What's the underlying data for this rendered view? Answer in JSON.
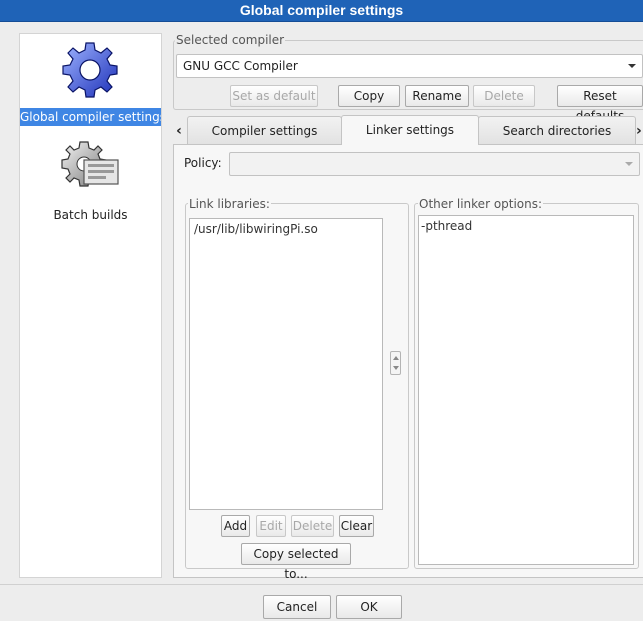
{
  "window": {
    "title": "Global compiler settings"
  },
  "sidebar": {
    "items": [
      {
        "label": "Global compiler settings",
        "icon": "gear-icon",
        "selected": true
      },
      {
        "label": "Batch builds",
        "icon": "gear-batch-icon",
        "selected": false
      }
    ]
  },
  "compiler": {
    "group_label": "Selected compiler",
    "selected_value": "GNU GCC Compiler",
    "buttons": {
      "set_default": "Set as default",
      "copy": "Copy",
      "rename": "Rename",
      "delete": "Delete",
      "reset": "Reset defaults"
    }
  },
  "tabs": [
    {
      "label": "Compiler settings",
      "active": false
    },
    {
      "label": "Linker settings",
      "active": true
    },
    {
      "label": "Search directories",
      "active": false
    }
  ],
  "linker": {
    "policy_label": "Policy:",
    "policy_value": "",
    "link_libraries": {
      "label": "Link libraries:",
      "items": [
        "/usr/lib/libwiringPi.so"
      ],
      "buttons": {
        "add": "Add",
        "edit": "Edit",
        "delete": "Delete",
        "clear": "Clear",
        "copy_to": "Copy selected to..."
      }
    },
    "other_options": {
      "label": "Other linker options:",
      "value": "-pthread"
    }
  },
  "dialog": {
    "cancel": "Cancel",
    "ok": "OK"
  },
  "colors": {
    "titlebar": "#1f63b7",
    "selection": "#3f86e4"
  }
}
